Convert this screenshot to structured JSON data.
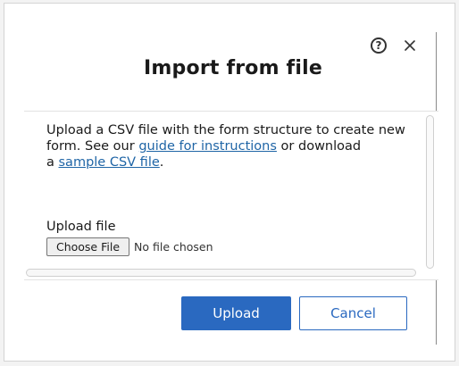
{
  "dialog": {
    "title": "Import from file",
    "help_icon": "question-circle-icon",
    "close_icon": "close-icon",
    "help_glyph": "?"
  },
  "description": {
    "text_1": "Upload a CSV file with the form structure to create new form. See our ",
    "link_1": "guide for instructions",
    "text_2": " or download",
    "text_3": "a ",
    "link_2": "sample CSV file",
    "text_4": "."
  },
  "upload": {
    "label": "Upload file",
    "choose_button": "Choose File",
    "status": "No file chosen"
  },
  "footer": {
    "upload_label": "Upload",
    "cancel_label": "Cancel"
  },
  "colors": {
    "accent": "#2a69c0",
    "link": "#1f65a6"
  }
}
